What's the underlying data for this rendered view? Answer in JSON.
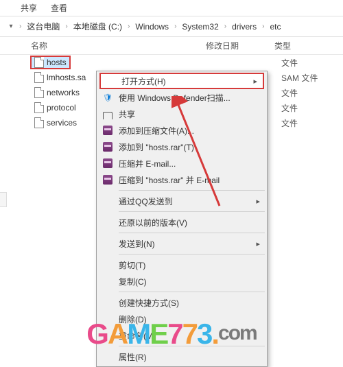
{
  "ribbon": {
    "share": "共享",
    "view": "查看"
  },
  "breadcrumb": {
    "items": [
      "这台电脑",
      "本地磁盘 (C:)",
      "Windows",
      "System32",
      "drivers",
      "etc"
    ]
  },
  "columns": {
    "name": "名称",
    "date": "修改日期",
    "type": "类型"
  },
  "files": [
    {
      "name": "hosts",
      "type": "文件"
    },
    {
      "name": "lmhosts.sa",
      "type": "SAM 文件"
    },
    {
      "name": "networks",
      "type": "文件"
    },
    {
      "name": "protocol",
      "type": "文件"
    },
    {
      "name": "services",
      "type": "文件"
    }
  ],
  "menu": {
    "open_with": "打开方式(H)",
    "defender": "使用 Windows Defender扫描...",
    "share": "共享",
    "add_archive": "添加到压缩文件(A)...",
    "add_hosts": "添加到 \"hosts.rar\"(T)",
    "compress_email": "压缩并 E-mail...",
    "compress_hosts_email": "压缩到 \"hosts.rar\" 并 E-mail",
    "qq_send": "通过QQ发送到",
    "restore": "还原以前的版本(V)",
    "send_to": "发送到(N)",
    "cut": "剪切(T)",
    "copy": "复制(C)",
    "shortcut": "创建快捷方式(S)",
    "delete": "删除(D)",
    "rename": "重命名(M)",
    "properties": "属性(R)"
  },
  "watermark": {
    "text": "GAME773",
    "suffix": ".com"
  }
}
